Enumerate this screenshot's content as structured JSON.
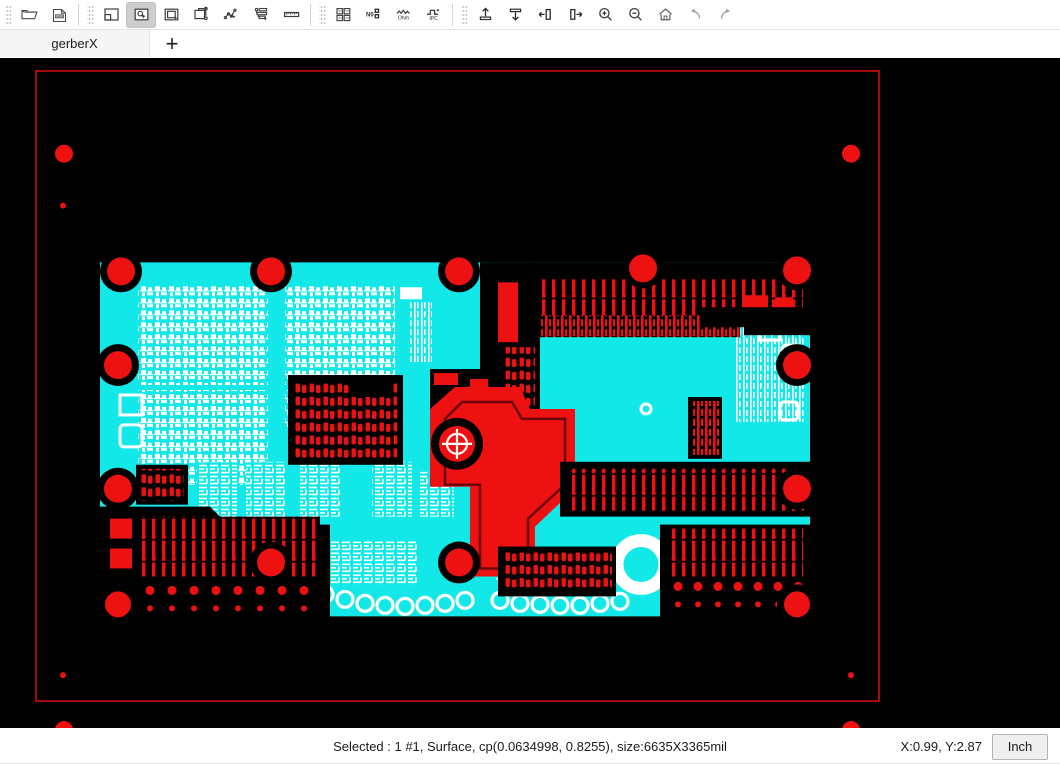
{
  "window": {
    "title": "gerberX"
  },
  "toolbar": {
    "groups": [
      {
        "name": "file",
        "buttons": [
          {
            "id": "open-file",
            "icon": "folder-open-icon",
            "label": "Open",
            "active": false
          },
          {
            "id": "export-pdf",
            "icon": "pdf-export-icon",
            "label": "PDF",
            "active": false
          }
        ]
      },
      {
        "name": "view-select",
        "buttons": [
          {
            "id": "layer-panel",
            "icon": "panel-layout-icon",
            "label": "Panel",
            "active": false
          },
          {
            "id": "select-tool",
            "icon": "select-cursor-icon",
            "label": "Select",
            "active": true
          },
          {
            "id": "area-select-tool",
            "icon": "area-select-icon",
            "label": "Area Select",
            "active": false
          },
          {
            "id": "transform-tool",
            "icon": "transform-icon",
            "label": "Transform",
            "active": false
          },
          {
            "id": "netlist-tool",
            "icon": "netlist-nodes-icon",
            "label": "Netlist",
            "active": false
          },
          {
            "id": "stackup-tool",
            "icon": "stackup-icon",
            "label": "Stackup",
            "active": false
          },
          {
            "id": "measure-tool",
            "icon": "ruler-icon",
            "label": "Measure",
            "active": false
          }
        ]
      },
      {
        "name": "analysis",
        "buttons": [
          {
            "id": "panelize",
            "icon": "panelize-array-icon",
            "label": "Panelize",
            "active": false
          },
          {
            "id": "no-tool",
            "icon": "no-marker-icon",
            "label": "NO",
            "active": false
          },
          {
            "id": "impedance",
            "icon": "ohm-icon",
            "label": "Ohm",
            "active": false
          },
          {
            "id": "ipc-netlist",
            "icon": "ipc-icon",
            "label": "IPC",
            "active": false
          }
        ]
      },
      {
        "name": "io-nav",
        "buttons": [
          {
            "id": "export-top",
            "icon": "export-up-icon",
            "label": "Export Top",
            "active": false
          },
          {
            "id": "import-bottom",
            "icon": "import-down-icon",
            "label": "Import Bottom",
            "active": false
          },
          {
            "id": "align-left",
            "icon": "align-left-icon",
            "label": "Align Left",
            "active": false
          },
          {
            "id": "align-right",
            "icon": "align-right-icon",
            "label": "Align Right",
            "active": false
          },
          {
            "id": "zoom-in",
            "icon": "zoom-in-icon",
            "label": "Zoom In",
            "active": false
          },
          {
            "id": "zoom-out",
            "icon": "zoom-out-icon",
            "label": "Zoom Out",
            "active": false
          },
          {
            "id": "zoom-home",
            "icon": "home-icon",
            "label": "Fit",
            "active": false
          },
          {
            "id": "undo",
            "icon": "undo-arrow-icon",
            "label": "Undo",
            "active": false
          },
          {
            "id": "redo",
            "icon": "redo-arrow-icon",
            "label": "Redo",
            "active": false
          }
        ]
      }
    ]
  },
  "tabs": {
    "items": [
      {
        "label": "gerberX",
        "selected": true
      }
    ],
    "add_label": "+"
  },
  "canvas": {
    "background": "#000000",
    "outline_color": "#ee1111",
    "copper_color": "#ee1111",
    "plane_color": "#12e8e8",
    "silk_color": "#ffffff",
    "cursor_marker": "crosshair-target-icon"
  },
  "statusbar": {
    "selection_text": "Selected : 1  #1, Surface, cp(0.0634998, 0.8255), size:6635X3365mil",
    "coordinates": "X:0.99, Y:2.87",
    "unit_label": "Inch"
  }
}
